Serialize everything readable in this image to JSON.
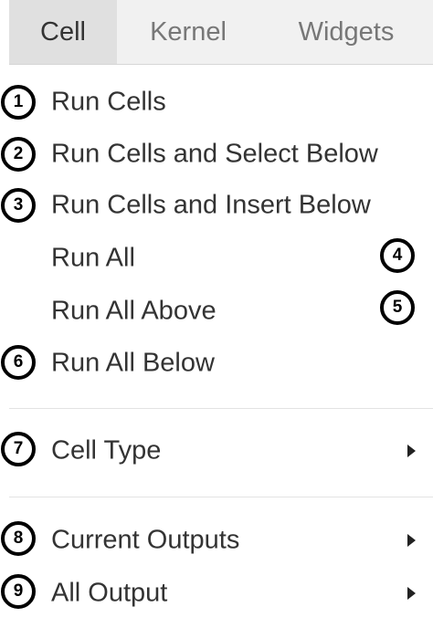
{
  "menubar": {
    "tabs": [
      {
        "label": "Cell",
        "active": true
      },
      {
        "label": "Kernel",
        "active": false
      },
      {
        "label": "Widgets",
        "active": false
      }
    ]
  },
  "cell_menu": {
    "items": [
      {
        "label": "Run Cells",
        "badge": "1",
        "has_submenu": false
      },
      {
        "label": "Run Cells and Select Below",
        "badge": "2",
        "has_submenu": false
      },
      {
        "label": "Run Cells and Insert Below",
        "badge": "3",
        "has_submenu": false
      },
      {
        "label": "Run All",
        "badge": "4",
        "has_submenu": false
      },
      {
        "label": "Run All Above",
        "badge": "5",
        "has_submenu": false
      },
      {
        "label": "Run All Below",
        "badge": "6",
        "has_submenu": false
      },
      {
        "label": "Cell Type",
        "badge": "7",
        "has_submenu": true
      },
      {
        "label": "Current Outputs",
        "badge": "8",
        "has_submenu": true
      },
      {
        "label": "All Output",
        "badge": "9",
        "has_submenu": true
      }
    ]
  },
  "icons": {
    "submenu": "caret-right-icon",
    "callout": "numbered-circle-icon"
  },
  "colors": {
    "menubar_bg": "#f1f1f1",
    "active_tab_bg": "#e0e0e0",
    "text": "#333333",
    "inactive_tab_text": "#777777",
    "callout_border": "#000000"
  }
}
